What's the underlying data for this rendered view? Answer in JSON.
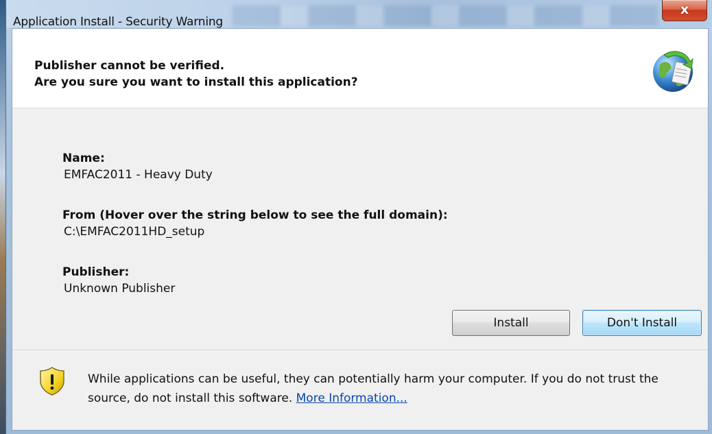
{
  "window": {
    "title": "Application Install - Security Warning",
    "close_glyph": "x"
  },
  "header": {
    "line1": "Publisher cannot be verified.",
    "line2": "Are you sure you want to install this application?",
    "icon": "globe-install-icon"
  },
  "details": {
    "name_label": "Name:",
    "name_value": "EMFAC2011 - Heavy Duty",
    "from_label": "From (Hover over the string below to see the full domain):",
    "from_value": "C:\\EMFAC2011HD_setup",
    "publisher_label": "Publisher:",
    "publisher_value": "Unknown Publisher"
  },
  "buttons": {
    "install": "Install",
    "dont_install": "Don't Install"
  },
  "footer": {
    "icon": "shield-warning-icon",
    "text": "While applications can be useful, they can potentially harm your computer. If you do not trust the source, do not install this software.",
    "link": "More Information..."
  },
  "colors": {
    "link": "#0645ad",
    "close_button": "#d2502f",
    "default_button_border": "#3c7fb1"
  }
}
